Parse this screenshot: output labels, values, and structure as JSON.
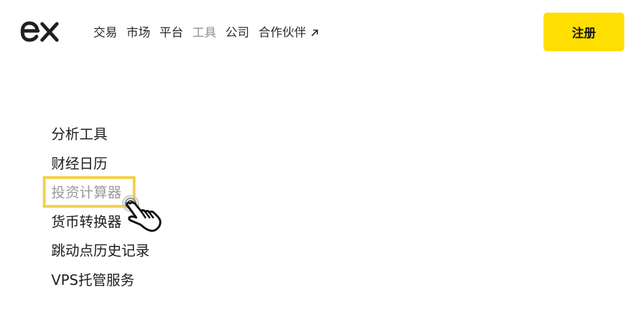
{
  "header": {
    "logo": "ex",
    "nav": [
      {
        "label": "交易"
      },
      {
        "label": "市场"
      },
      {
        "label": "平台"
      },
      {
        "label": "工具"
      },
      {
        "label": "公司"
      },
      {
        "label": "合作伙伴",
        "icon": "external-arrow-icon"
      }
    ],
    "signup_label": "注册"
  },
  "menu": {
    "items": [
      {
        "label": "分析工具"
      },
      {
        "label": "财经日历"
      },
      {
        "label": "投资计算器",
        "state": "hovered"
      },
      {
        "label": "货币转换器"
      },
      {
        "label": "跳动点历史记录"
      },
      {
        "label": "VPS托管服务"
      }
    ]
  },
  "colors": {
    "accent": "#ffde02",
    "highlight": "#f4d04c",
    "text": "#1d1d1d",
    "muted": "#9a9a9a"
  },
  "cursor": {
    "icon": "hand-pointer-icon"
  }
}
